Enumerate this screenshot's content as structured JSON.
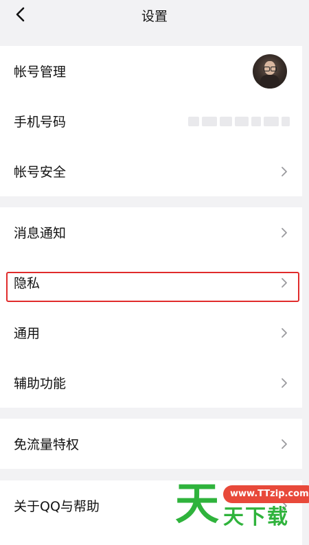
{
  "header": {
    "title": "设置"
  },
  "group1": [
    {
      "label": "帐号管理"
    },
    {
      "label": "手机号码"
    },
    {
      "label": "帐号安全"
    }
  ],
  "group2": [
    {
      "label": "消息通知"
    },
    {
      "label": "隐私"
    },
    {
      "label": "通用"
    },
    {
      "label": "辅助功能"
    }
  ],
  "group3": [
    {
      "label": "免流量特权"
    }
  ],
  "group4": [
    {
      "label": "关于QQ与帮助"
    }
  ],
  "watermark": {
    "big": "天",
    "url": "www.TTzip.com",
    "small": "天下载"
  },
  "colors": {
    "highlight": "#e02b2b",
    "watermark_green": "#2fb33c",
    "watermark_red": "#e8493a"
  }
}
